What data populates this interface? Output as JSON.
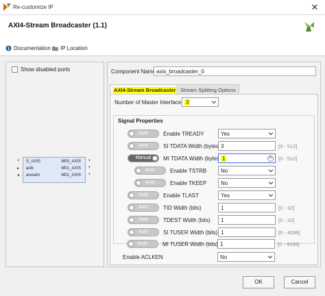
{
  "window": {
    "title": "Re-customize IP",
    "close_glyph": "✕"
  },
  "header": {
    "heading": "AXI4-Stream Broadcaster (1.1)"
  },
  "links": {
    "documentation": "Documentation",
    "ip_location": "IP Location"
  },
  "left": {
    "show_disabled_label": "Show disabled ports",
    "symbol_pins": {
      "left": [
        "S_AXIS",
        "aclk",
        "aresetn"
      ],
      "right": [
        "M00_AXIS",
        "M01_AXIS",
        "M02_AXIS"
      ]
    }
  },
  "form": {
    "component_name_label": "Component Name",
    "component_name_value": "axis_broadcaster_0",
    "tabs": [
      "AXI4-Stream Broadcaster",
      "Stream Splitting Options"
    ],
    "num_master_label": "Number of Master Interfaces",
    "num_master_value": "3",
    "signal_group_title": "Signal Properties",
    "rows": [
      {
        "toggle": "Auto",
        "label": "Enable TREADY",
        "value": "Yes",
        "type": "select",
        "range": ""
      },
      {
        "toggle": "Auto",
        "label": "SI TDATA Width (bytes)",
        "value": "3",
        "type": "field",
        "range": "[0 - 512]"
      },
      {
        "toggle": "Manual",
        "label": "MI TDATA Width (bytes)",
        "value": "1",
        "type": "focused",
        "range": "[0 - 512]"
      },
      {
        "toggle": "Auto",
        "label": "Enable TSTRB",
        "value": "No",
        "type": "select",
        "range": ""
      },
      {
        "toggle": "Auto",
        "label": "Enable TKEEP",
        "value": "No",
        "type": "select",
        "range": ""
      },
      {
        "toggle": "Auto",
        "label": "Enable TLAST",
        "value": "Yes",
        "type": "select",
        "range": ""
      },
      {
        "toggle": "Auto",
        "label": "TID Width (bits)",
        "value": "1",
        "type": "field",
        "range": "[0 - 32]"
      },
      {
        "toggle": "Auto",
        "label": "TDEST Width (bits)",
        "value": "1",
        "type": "field",
        "range": "[0 - 32]"
      },
      {
        "toggle": "Auto",
        "label": "SI TUSER Width (bits)",
        "value": "1",
        "type": "field",
        "range": "[0 - 4096]"
      },
      {
        "toggle": "Auto",
        "label": "MI TUSER Width (bits)",
        "value": "1",
        "type": "field",
        "range": "[0 - 4096]"
      }
    ],
    "aclken_label": "Enable ACLKEN",
    "aclken_value": "No"
  },
  "footer": {
    "ok": "OK",
    "cancel": "Cancel"
  }
}
